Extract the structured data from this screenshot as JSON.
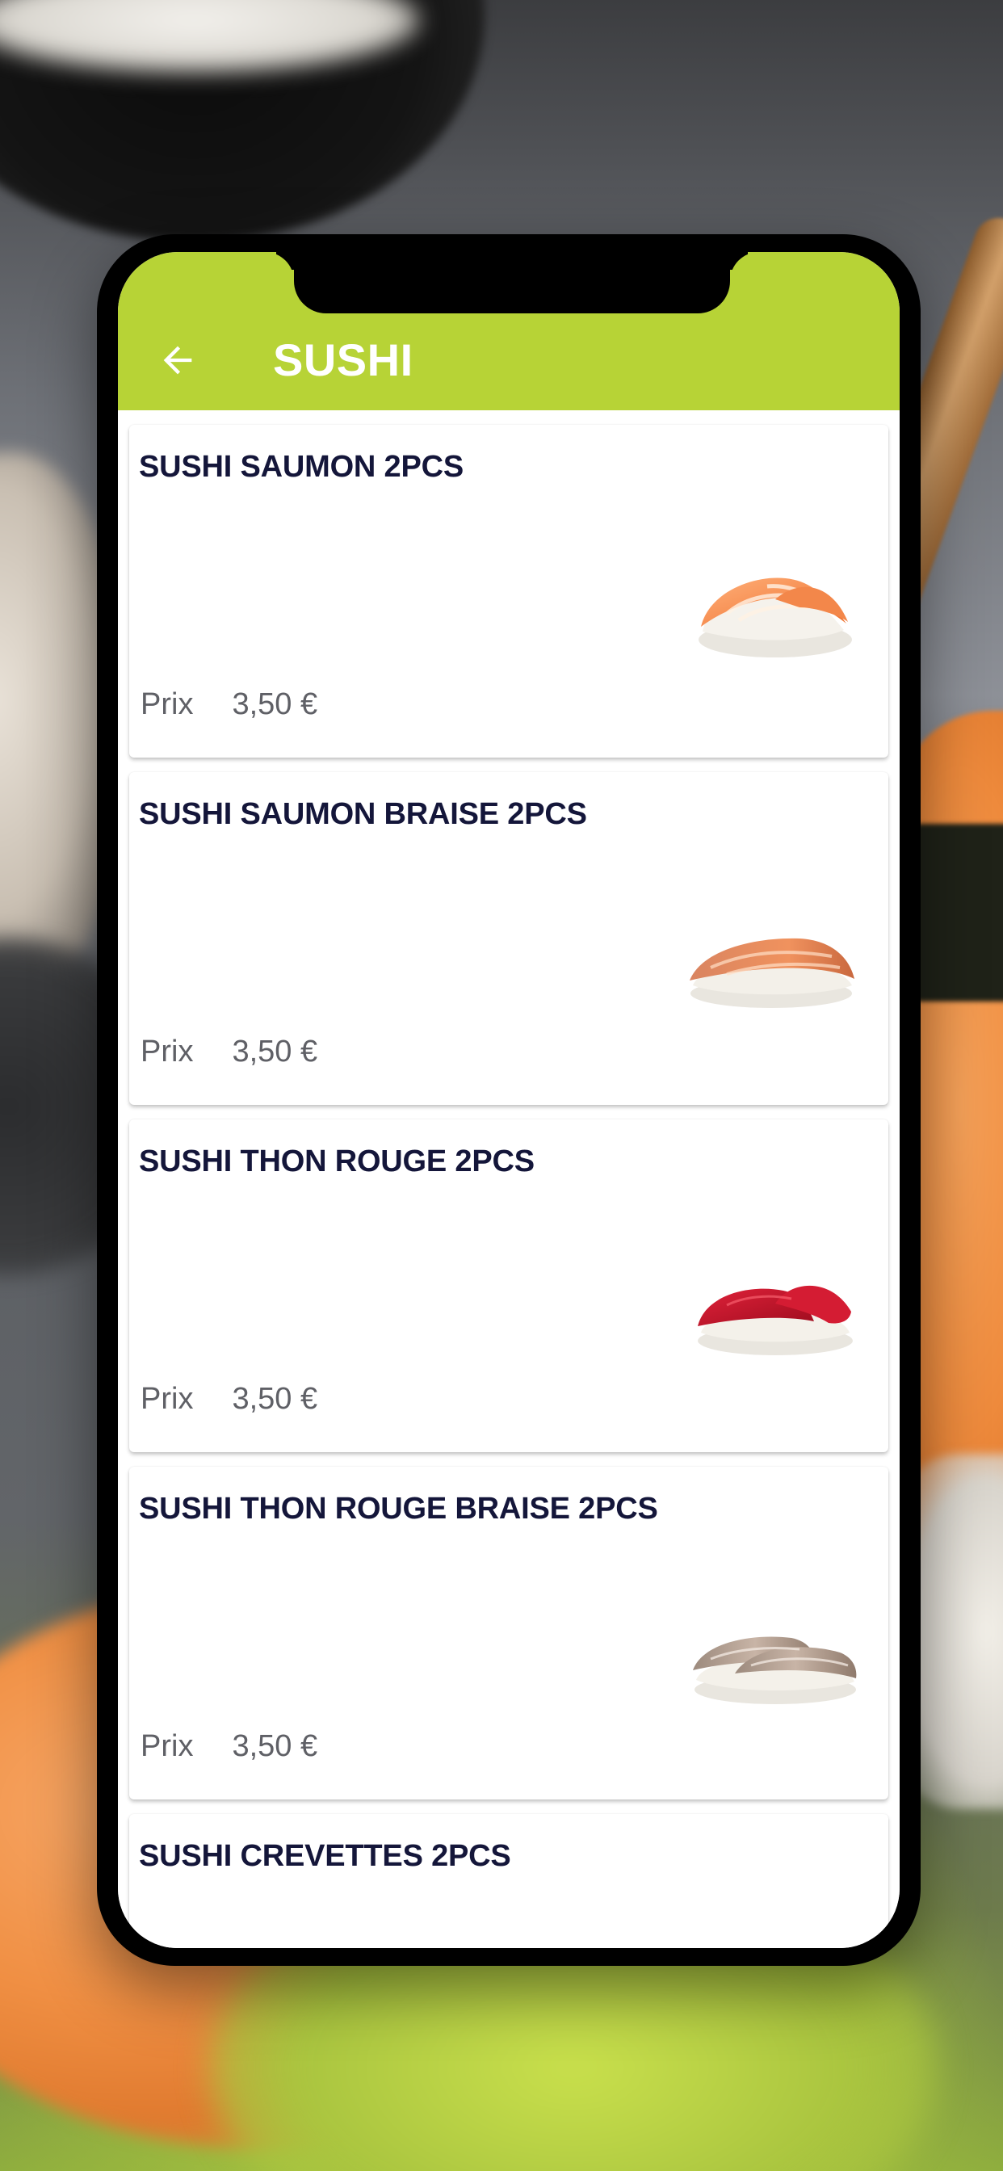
{
  "colors": {
    "accent": "#b7d336",
    "title_text": "#ffffff",
    "item_name": "#14163a",
    "price_text": "#5f6066"
  },
  "header": {
    "back_icon": "arrow-left-icon",
    "title": "SUSHI"
  },
  "items": [
    {
      "name": "SUSHI SAUMON 2PCS",
      "price_label": "Prix",
      "price": "3,50 €",
      "image": "salmon-nigiri"
    },
    {
      "name": "SUSHI SAUMON BRAISE 2PCS",
      "price_label": "Prix",
      "price": "3,50 €",
      "image": "seared-salmon-nigiri"
    },
    {
      "name": "SUSHI THON ROUGE 2PCS",
      "price_label": "Prix",
      "price": "3,50 €",
      "image": "red-tuna-nigiri"
    },
    {
      "name": "SUSHI THON ROUGE BRAISE 2PCS",
      "price_label": "Prix",
      "price": "3,50 €",
      "image": "seared-tuna-nigiri"
    },
    {
      "name": "SUSHI CREVETTES 2PCS"
    }
  ]
}
